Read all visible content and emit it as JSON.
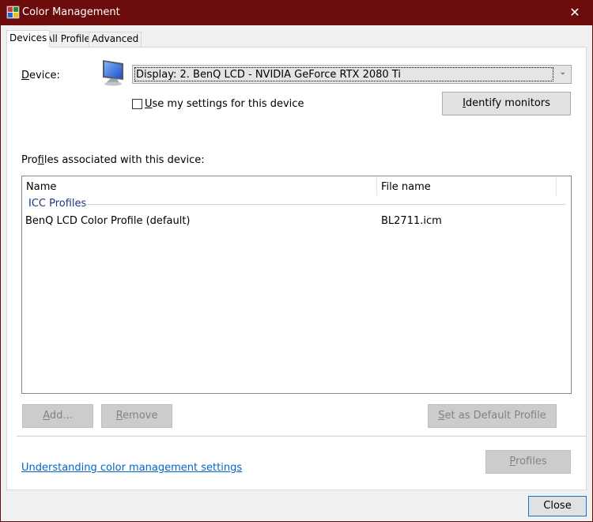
{
  "window": {
    "title": "Color Management",
    "close_glyph": "✕",
    "accent_color": "#6b0b0b"
  },
  "tabs": [
    {
      "label": "Devices",
      "active": true
    },
    {
      "label": "All Profiles",
      "active": false
    },
    {
      "label": "Advanced",
      "active": false
    }
  ],
  "device": {
    "label_prefix": "D",
    "label_rest": "evice:",
    "icon": "monitor-icon",
    "selected": "Display: 2. BenQ LCD - NVIDIA GeForce RTX 2080 Ti",
    "use_settings_prefix": "U",
    "use_settings_rest": "se my settings for this device",
    "use_settings_checked": false,
    "identify_button_prefix": "I",
    "identify_button_rest": "dentify monitors"
  },
  "profiles": {
    "section_label_a": "Pro",
    "section_label_ul": "f",
    "section_label_b": "iles associated with this device:",
    "columns": [
      "Name",
      "File name"
    ],
    "group": "ICC Profiles",
    "rows": [
      {
        "name": "BenQ LCD Color Profile (default)",
        "file": "BL2711.icm"
      }
    ]
  },
  "buttons": {
    "add_ul": "A",
    "add_rest": "dd...",
    "remove_ul": "R",
    "remove_rest": "emove",
    "set_default_ul": "S",
    "set_default_rest": "et as Default Profile",
    "profiles_ul": "P",
    "profiles_rest": "rofiles",
    "close": "Close"
  },
  "link": {
    "text": "Understanding color management settings"
  }
}
